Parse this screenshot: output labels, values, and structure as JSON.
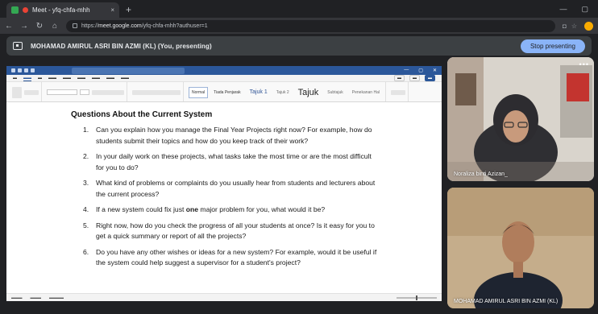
{
  "browser": {
    "tab_title": "Meet - yfq-chfa-mhh",
    "tab_close": "×",
    "new_tab": "+",
    "url_prefix": "https://",
    "url_host": "meet.google.com",
    "url_path": "/yfq-chfa-mhh?authuser=1"
  },
  "banner": {
    "presenter_text": "MOHAMAD AMIRUL ASRI BIN AZMI (KL) (You, presenting)",
    "stop_label": "Stop presenting"
  },
  "word": {
    "ribbon_styles": [
      "Normal",
      "Tiada Penjarak",
      "Tajuk 1",
      "Tajuk 2",
      "Tajuk",
      "Subtajuk",
      "Penekanan Hal"
    ]
  },
  "document": {
    "heading": "Questions About the Current System",
    "questions": [
      {
        "num": "1.",
        "text": "Can you explain how you manage the Final Year Projects right now? For example, how do students submit their topics and how do you keep track of their work?"
      },
      {
        "num": "2.",
        "text": "In your daily work on these projects, what tasks take the most time or are the most difficult for you to do?"
      },
      {
        "num": "3.",
        "text": "What kind of problems or complaints do you usually hear from students and lecturers about the current process?"
      },
      {
        "num": "4.",
        "pre": "If a new system could fix just ",
        "bold": "one",
        "post": " major problem for you, what would it be?"
      },
      {
        "num": "5.",
        "text": "Right now, how do you check the progress of all your students at once? Is it easy for you to get a quick summary or report of all the projects?"
      },
      {
        "num": "6.",
        "text": "Do you have any other wishes or ideas for a new system? For example, would it be useful if the system could help suggest a supervisor for a student's project?"
      }
    ]
  },
  "participants": {
    "p1_name": "Noraliza binti Azizan_",
    "p2_name": "MOHAMAD AMIRUL ASRI BIN AZMI (KL)"
  },
  "colors": {
    "meet_bg": "#202124",
    "word_blue": "#2b579a",
    "stop_button": "#8ab4f8"
  }
}
